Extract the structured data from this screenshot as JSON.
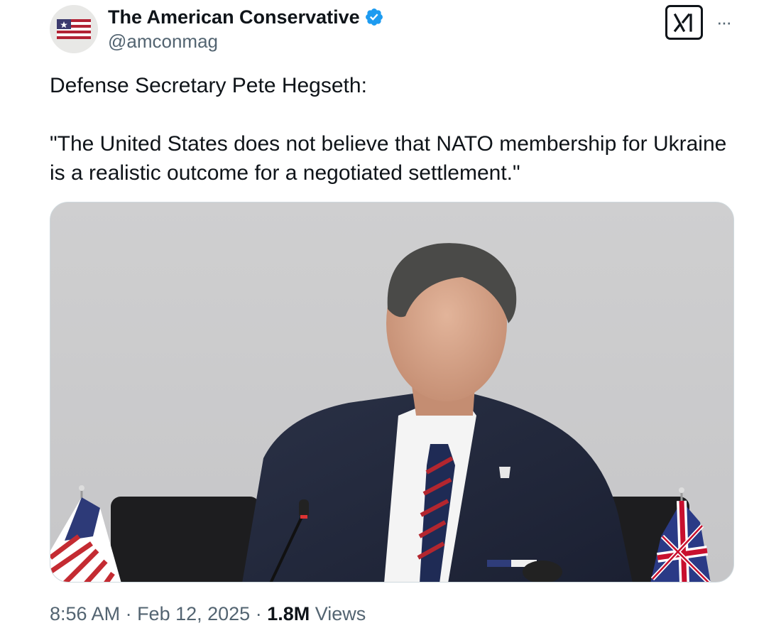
{
  "author": {
    "name": "The American Conservative",
    "handle": "@amconmag",
    "verified": true,
    "avatar_icon": "american-flag-icon"
  },
  "actions": {
    "grok_icon": "xai-grok-icon",
    "more_icon": "more-horizontal-icon",
    "more_label": "···"
  },
  "tweet": {
    "line1": "Defense Secretary Pete Hegseth:",
    "line2": "\"The United States does not believe that NATO membership for Ukraine is a realistic outcome for a negotiated settlement.\""
  },
  "meta": {
    "time": "8:56 AM",
    "sep1": " · ",
    "date": "Feb 12, 2025",
    "sep2": " · ",
    "views_count": "1.8M",
    "views_label": " Views"
  },
  "colors": {
    "verified": "#1d9bf0",
    "secondary_text": "#536471",
    "primary_text": "#0f1419"
  }
}
